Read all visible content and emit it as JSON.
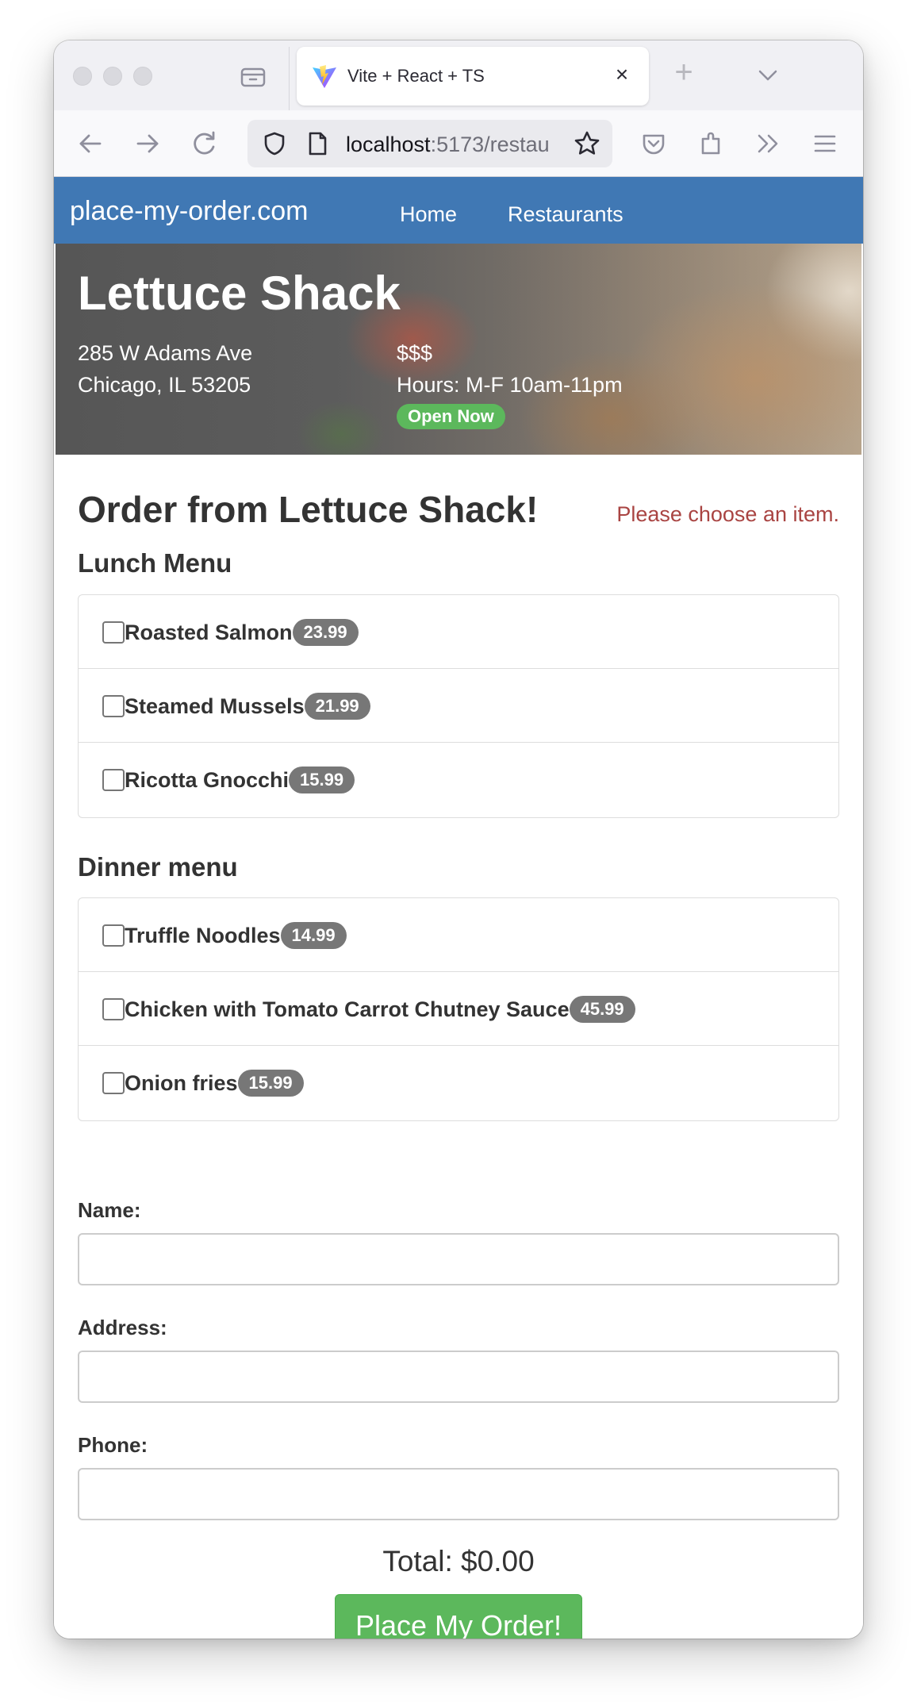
{
  "browser": {
    "tab_title": "Vite + React + TS",
    "tab_close": "×",
    "new_tab": "+",
    "url_host": "localhost",
    "url_rest": ":5173/restau"
  },
  "site": {
    "brand": "place-my-order.com",
    "nav": [
      "Home",
      "Restaurants"
    ]
  },
  "restaurant": {
    "name": "Lettuce Shack",
    "address_line1": "285 W Adams Ave",
    "address_line2": "Chicago, IL 53205",
    "price": "$$$",
    "hours": "Hours: M-F 10am-11pm",
    "status": "Open Now"
  },
  "order": {
    "title": "Order from Lettuce Shack!",
    "alert": "Please choose an item.",
    "lunch": {
      "heading": "Lunch Menu",
      "items": [
        {
          "name": "Roasted Salmon",
          "price": "23.99"
        },
        {
          "name": "Steamed Mussels",
          "price": "21.99"
        },
        {
          "name": "Ricotta Gnocchi",
          "price": "15.99"
        }
      ]
    },
    "dinner": {
      "heading": "Dinner menu",
      "items": [
        {
          "name": "Truffle Noodles",
          "price": "14.99"
        },
        {
          "name": "Chicken with Tomato Carrot Chutney Sauce",
          "price": "45.99"
        },
        {
          "name": "Onion fries",
          "price": "15.99"
        }
      ]
    },
    "form": {
      "name_label": "Name:",
      "name_value": "",
      "address_label": "Address:",
      "address_value": "",
      "phone_label": "Phone:",
      "phone_value": ""
    },
    "total": "Total: $0.00",
    "submit_label": "Place My Order!"
  },
  "colors": {
    "nav_bg": "#4078b4",
    "badge_green": "#5cb85c",
    "price_badge": "#777777",
    "alert_text": "#a94442"
  }
}
